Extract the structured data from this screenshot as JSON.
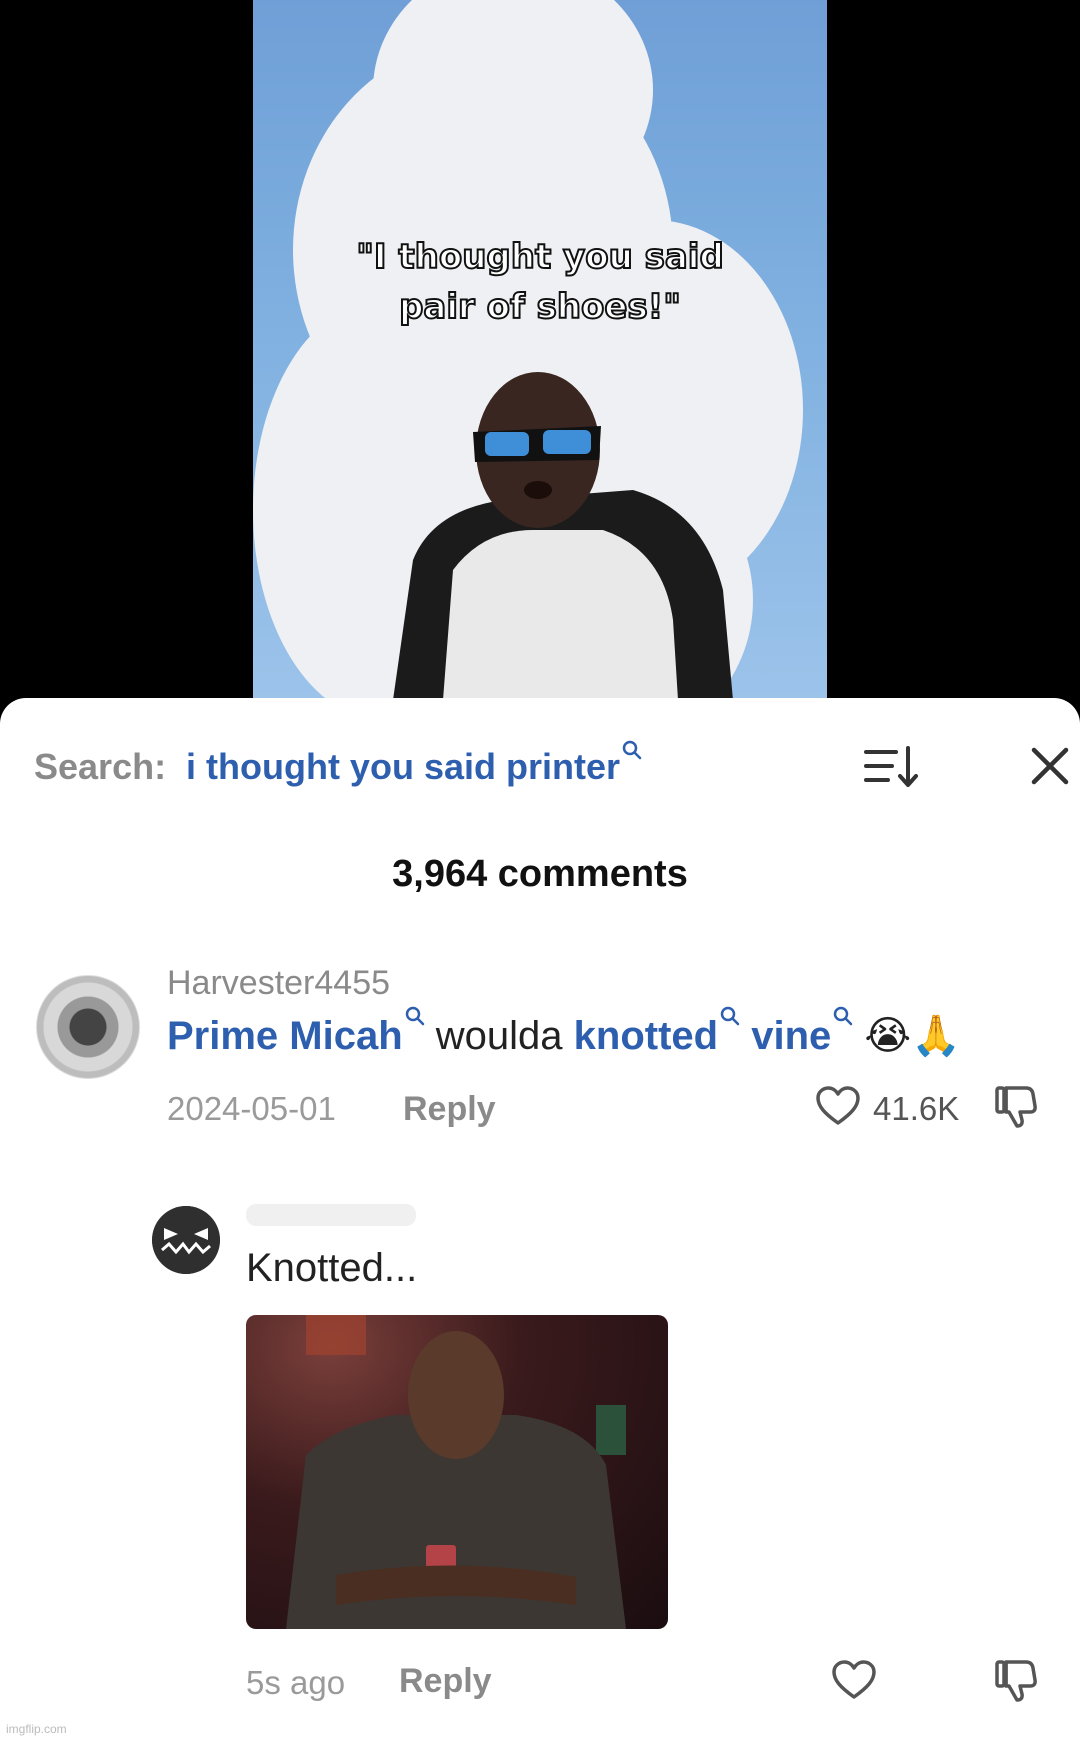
{
  "video": {
    "caption_line1": "\"I thought you said",
    "caption_line2": "pair of shoes!\""
  },
  "header": {
    "search_label": "Search:",
    "search_query": "i thought you said printer",
    "comment_count": "3,964 comments",
    "icons": [
      "search-icon",
      "sort-icon",
      "close-icon"
    ]
  },
  "comments": [
    {
      "username": "Harvester4455",
      "parts": [
        {
          "text": "Prime Micah",
          "highlight": true
        },
        {
          "text": " woulda ",
          "highlight": false
        },
        {
          "text": "knotted",
          "highlight": true
        },
        {
          "text": " ",
          "highlight": false
        },
        {
          "text": "vine",
          "highlight": true
        },
        {
          "text": " 😭🙏",
          "highlight": false
        }
      ],
      "date": "2024-05-01",
      "reply_label": "Reply",
      "likes": "41.6K"
    },
    {
      "username": "",
      "text": "Knotted...",
      "time": "5s ago",
      "reply_label": "Reply"
    }
  ],
  "watermark": "imgflip.com",
  "colors": {
    "accent": "#2d5fae",
    "muted": "#8a8a8a"
  }
}
